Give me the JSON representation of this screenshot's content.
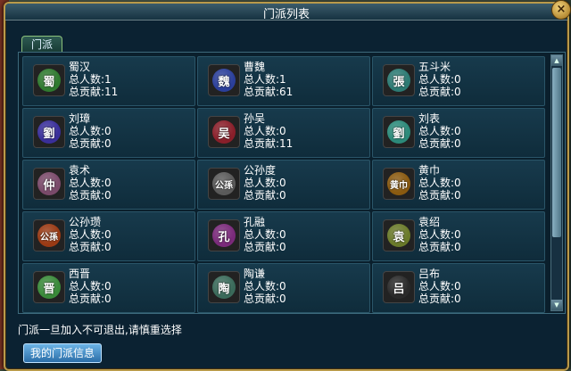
{
  "window": {
    "title": "门派列表",
    "close_label": "×"
  },
  "tab": {
    "label": "门派"
  },
  "factions": [
    {
      "name": "蜀汉",
      "emblem": "蜀",
      "members": "总人数:1",
      "contribution": "总贡献:11",
      "emblem_color": "#2f7a2f"
    },
    {
      "name": "曹魏",
      "emblem": "魏",
      "members": "总人数:1",
      "contribution": "总贡献:61",
      "emblem_color": "#2b3f9a"
    },
    {
      "name": "五斗米",
      "emblem": "張",
      "members": "总人数:0",
      "contribution": "总贡献:0",
      "emblem_color": "#2c7a73"
    },
    {
      "name": "刘璋",
      "emblem": "劉",
      "members": "总人数:0",
      "contribution": "总贡献:0",
      "emblem_color": "#3a2f9a"
    },
    {
      "name": "孙吴",
      "emblem": "吴",
      "members": "总人数:0",
      "contribution": "总贡献:11",
      "emblem_color": "#8a1f2a"
    },
    {
      "name": "刘表",
      "emblem": "劉",
      "members": "总人数:0",
      "contribution": "总贡献:0",
      "emblem_color": "#2c8a7a"
    },
    {
      "name": "袁术",
      "emblem": "仲",
      "members": "总人数:0",
      "contribution": "总贡献:0",
      "emblem_color": "#7a4a6a"
    },
    {
      "name": "公孙度",
      "emblem": "公孫",
      "members": "总人数:0",
      "contribution": "总贡献:0",
      "emblem_color": "#5a5a5a"
    },
    {
      "name": "黄巾",
      "emblem": "黄巾",
      "members": "总人数:0",
      "contribution": "总贡献:0",
      "emblem_color": "#8a5a10"
    },
    {
      "name": "公孙瓒",
      "emblem": "公孫",
      "members": "总人数:0",
      "contribution": "总贡献:0",
      "emblem_color": "#9a3a14"
    },
    {
      "name": "孔融",
      "emblem": "孔",
      "members": "总人数:0",
      "contribution": "总贡献:0",
      "emblem_color": "#7a2a7a"
    },
    {
      "name": "袁绍",
      "emblem": "袁",
      "members": "总人数:0",
      "contribution": "总贡献:0",
      "emblem_color": "#6a7a2a"
    },
    {
      "name": "西晋",
      "emblem": "晋",
      "members": "总人数:0",
      "contribution": "总贡献:0",
      "emblem_color": "#3a8a3a"
    },
    {
      "name": "陶谦",
      "emblem": "陶",
      "members": "总人数:0",
      "contribution": "总贡献:0",
      "emblem_color": "#3a6a5a"
    },
    {
      "name": "吕布",
      "emblem": "吕",
      "members": "总人数:0",
      "contribution": "总贡献:0",
      "emblem_color": "#2a2a2a"
    }
  ],
  "footer": {
    "notice": "门派一旦加入不可退出,请慎重选择",
    "my_info_button": "我的门派信息"
  },
  "scrollbar": {
    "position": 0.0
  }
}
